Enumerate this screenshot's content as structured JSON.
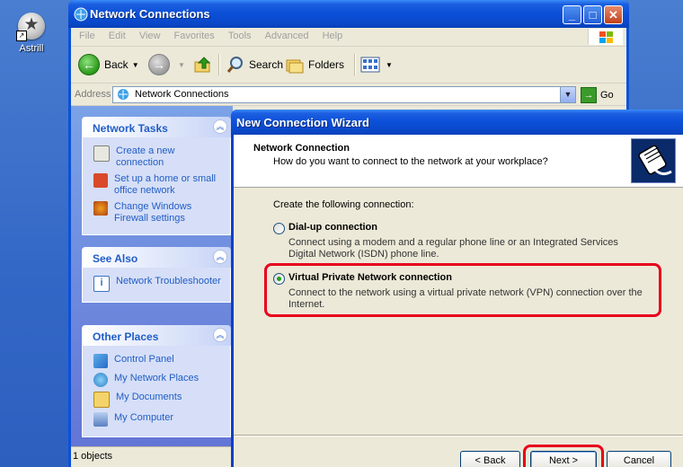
{
  "desktop": {
    "icon_label": "Astrill"
  },
  "window": {
    "title": "Network Connections",
    "menu": [
      "File",
      "Edit",
      "View",
      "Favorites",
      "Tools",
      "Advanced",
      "Help"
    ],
    "toolbar": {
      "back": "Back",
      "search": "Search",
      "folders": "Folders"
    },
    "address": {
      "label": "Address",
      "value": "Network Connections",
      "go": "Go"
    },
    "panels": {
      "network_tasks": {
        "title": "Network Tasks",
        "items": [
          "Create a new connection",
          "Set up a home or small office network",
          "Change Windows Firewall settings"
        ]
      },
      "see_also": {
        "title": "See Also",
        "items": [
          "Network Troubleshooter"
        ]
      },
      "other_places": {
        "title": "Other Places",
        "items": [
          "Control Panel",
          "My Network Places",
          "My Documents",
          "My Computer"
        ]
      }
    },
    "status": "1 objects"
  },
  "wizard": {
    "title": "New Connection Wizard",
    "header_title": "Network Connection",
    "header_subtitle": "How do you want to connect to the network at your workplace?",
    "intro": "Create the following connection:",
    "options": [
      {
        "label": "Dial-up connection",
        "desc": "Connect using a modem and a regular phone line or an Integrated Services Digital Network (ISDN) phone line.",
        "selected": false
      },
      {
        "label": "Virtual Private Network connection",
        "desc": "Connect to the network using a virtual private network (VPN) connection over the Internet.",
        "selected": true
      }
    ],
    "buttons": {
      "back": "< Back",
      "next": "Next >",
      "cancel": "Cancel"
    }
  },
  "colors": {
    "highlight": "#e8001c",
    "xp_blue": "#0a52d8",
    "task_link": "#215dc6"
  }
}
